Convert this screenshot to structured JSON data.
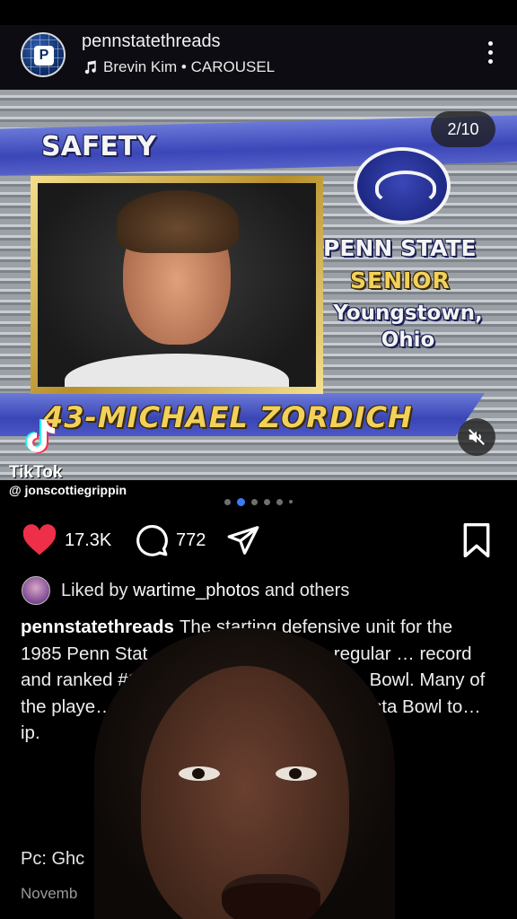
{
  "post": {
    "username": "pennstatethreads",
    "audio_label": "Brevin Kim • CAROUSEL",
    "avatar_letter": "P"
  },
  "media": {
    "counter": "2/10",
    "position_label": "SAFETY",
    "school": "PENN STATE",
    "year": "SENIOR",
    "hometown_line1": "Youngstown,",
    "hometown_line2": "Ohio",
    "player": "43-MICHAEL ZORDICH",
    "active_slide": 2,
    "total_dots_visible": 6
  },
  "watermark": {
    "brand": "TikTok",
    "handle": "@ jonscottiegrippin"
  },
  "actions": {
    "likes": "17.3K",
    "comments": "772"
  },
  "liked_by": {
    "prefix": "Liked by",
    "user": "wartime_photos",
    "suffix": "and others"
  },
  "caption": {
    "author": "pennstatethreads",
    "text": "The starting defensive unit for the 1985 Penn Stat… n State finished the regular … record and ranked #1… ns would lose 25-10 to… Bowl. Many of the playe… the following year and… 87 Fiesta Bowl to… ip.",
    "pc": "Pc: Ghc",
    "date": "Novemb"
  },
  "colors": {
    "like_red": "#ed2f4a",
    "dot_active": "#3b7cf6",
    "background": "#000000"
  }
}
